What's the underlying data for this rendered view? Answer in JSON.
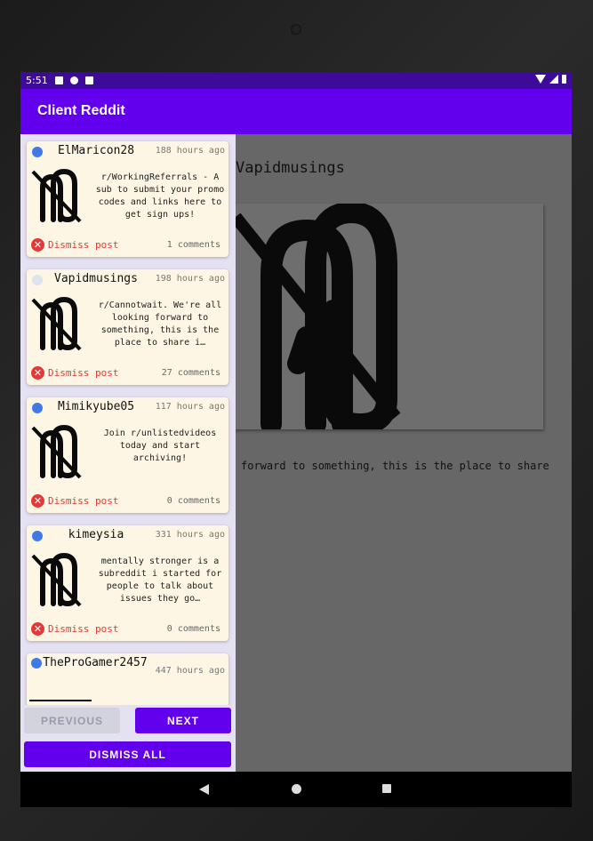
{
  "status_bar": {
    "time": "5:51"
  },
  "app": {
    "title": "Client Reddit"
  },
  "detail": {
    "author": "Vapidmusings",
    "body": "forward to something, this is the place to share"
  },
  "posts": [
    {
      "author": "ElMaricon28",
      "time_ago": "188 hours ago",
      "title": "r/WorkingReferrals - A sub to submit your promo codes and links here to get sign ups!",
      "dismiss_label": "Dismiss post",
      "comments": "1 comments",
      "read": false
    },
    {
      "author": "Vapidmusings",
      "time_ago": "198 hours ago",
      "title": "r/Cannotwait. We're all looking forward to something, this is the place to share i…",
      "dismiss_label": "Dismiss post",
      "comments": "27 comments",
      "read": true
    },
    {
      "author": "Mimikyube05",
      "time_ago": "117 hours ago",
      "title": "Join r/unlistedvideos today and start archiving!",
      "dismiss_label": "Dismiss post",
      "comments": "0 comments",
      "read": false
    },
    {
      "author": "kimeysia",
      "time_ago": "331 hours ago",
      "title": "mentally stronger is a subreddit i started for people to talk about issues they go…",
      "dismiss_label": "Dismiss post",
      "comments": "0 comments",
      "read": false
    },
    {
      "author": "TheProGamer2457",
      "time_ago": "447 hours ago",
      "read": false
    }
  ],
  "buttons": {
    "previous": "PREVIOUS",
    "next": "NEXT",
    "dismiss_all": "DISMISS ALL"
  },
  "icons": {
    "thumbnail": "broken-image-icon",
    "dismiss": "close-circle-icon"
  },
  "colors": {
    "primary": "#6200ee",
    "status_bar": "#3d0a99",
    "unread_dot": "#3f7be8",
    "dismiss": "#e53935",
    "card_bg": "#fdf6e4"
  }
}
